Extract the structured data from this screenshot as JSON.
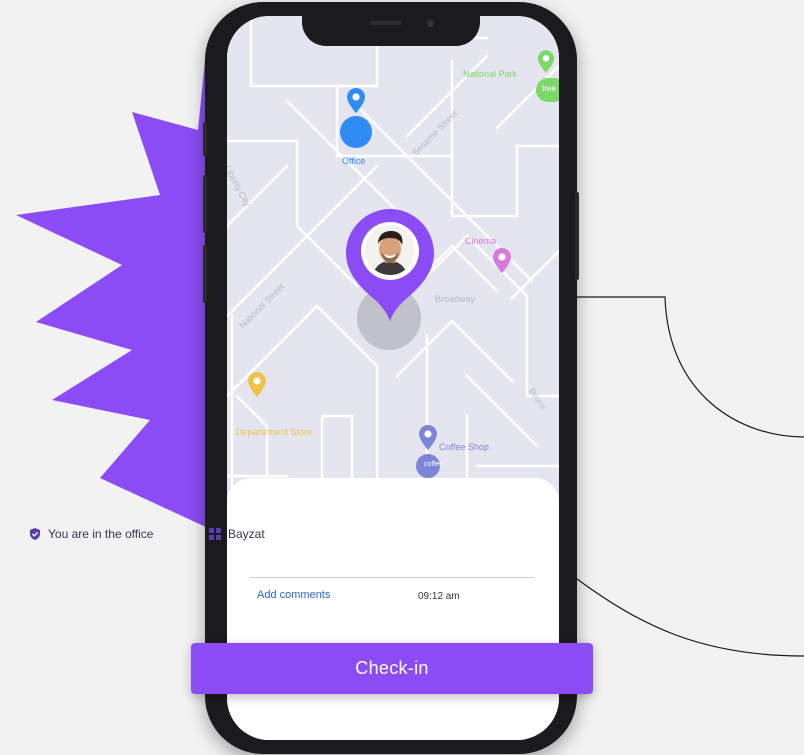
{
  "map": {
    "labels": {
      "office": "Office",
      "national_park": "National Park",
      "tree": "tree",
      "sesame_street": "Sesame Street",
      "liberty_city": "Liberty City",
      "cinema": "Cinema",
      "broadway": "Broadway",
      "national_street": "National Street",
      "department_store": "Departement Store",
      "coffee_shop": "Coffee Shop",
      "coffee_badge": "coffee",
      "bronx": "Bronx"
    }
  },
  "panel": {
    "status_text": "You are in the office",
    "company_name": "Bayzat",
    "add_comments": "Add comments",
    "time": "09:12 am"
  },
  "action": {
    "checkin_label": "Check-in"
  },
  "colors": {
    "accent_purple": "#8c4cf5",
    "office_blue": "#2f8cf5",
    "park_green": "#7dd86a",
    "cinema_pink": "#d879dc",
    "store_yellow": "#f0c24a",
    "coffee_indigo": "#7f85d6",
    "link_blue": "#2a66d1",
    "text_dark": "#3b3253"
  }
}
